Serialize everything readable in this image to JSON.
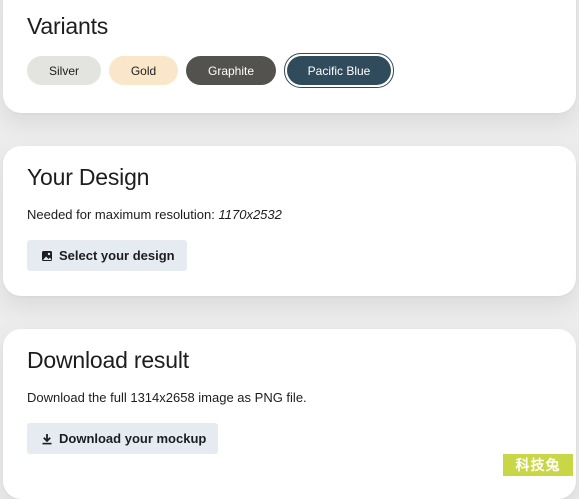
{
  "variants": {
    "title": "Variants",
    "options": [
      {
        "label": "Silver",
        "color": "#e3e4df"
      },
      {
        "label": "Gold",
        "color": "#fae6c9"
      },
      {
        "label": "Graphite",
        "color": "#54524f"
      },
      {
        "label": "Pacific Blue",
        "color": "#2f4b5c",
        "selected": true
      }
    ]
  },
  "design": {
    "title": "Your Design",
    "desc_prefix": "Needed for maximum resolution:",
    "resolution": "1170x2532",
    "button_label": "Select your design",
    "button_icon": "image-icon"
  },
  "download": {
    "title": "Download result",
    "desc": "Download the full 1314x2658 image as PNG file.",
    "button_label": "Download your mockup",
    "button_icon": "download-icon"
  },
  "watermark": {
    "text": "科技兔",
    "color": "#c9d646"
  }
}
